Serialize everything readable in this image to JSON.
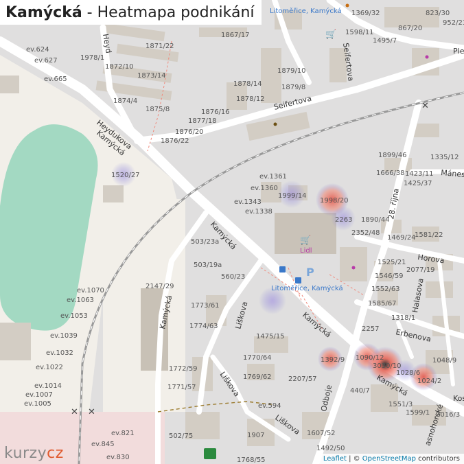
{
  "title": {
    "place": "Kamýcká",
    "separator": " - ",
    "subtitle": "Heatmapa podnikání"
  },
  "logo": {
    "part1": "kurzy",
    "part2": "cz"
  },
  "attribution": {
    "leaflet": "Leaflet",
    "sep": " | © ",
    "osm": "OpenStreetMap",
    "suffix": " contributors"
  },
  "streets": {
    "kamycka": "Kamýcká",
    "heydukova": "Heydukova",
    "seifertova": "Seifertova",
    "liskova": "Liškova",
    "odboje": "Odboje",
    "rijna": "28. října",
    "horova": "Horova",
    "halasova": "Halasova",
    "erbenova": "Erbenova",
    "manesova": "Mánes",
    "ples": "Ple",
    "kos": "Kos",
    "vodnohorske": "asnohorské",
    "heyd": "Heyd"
  },
  "pois": {
    "stop": "Litoměřice, Kamýcká",
    "stop2": "Litoměřice, Kamýcká",
    "lidl": "Lidl",
    "parking": "P"
  },
  "address_labels": [
    "1369/32",
    "823/30",
    "867/20",
    "952/23",
    "1598/11",
    "1495/7",
    "1867/17",
    "1871/22",
    "1978/1",
    "1872/10",
    "1873/14",
    "ev.624",
    "ev.627",
    "ev.665",
    "1879/10",
    "1878/14",
    "1879/8",
    "1874/4",
    "1875/8",
    "1878/12",
    "1876/16",
    "1877/18",
    "1876/20",
    "1876/22",
    "1335/12",
    "1899/46",
    "1666/38",
    "1423/11",
    "1425/37",
    "ev.1361",
    "ev.1360",
    "1999/14",
    "1998/20",
    "ev.1343",
    "ev.1338",
    "2263",
    "1890/44",
    "1520/27",
    "2352/48",
    "1469/24",
    "1581/22",
    "503/23a",
    "503/19a",
    "560/23",
    "1525/21",
    "2077/19",
    "1546/59",
    "1552/63",
    "1585/67",
    "2147/29",
    "ev.1070",
    "ev.1063",
    "1773/61",
    "1774/63",
    "ev.1053",
    "1318/1",
    "ev.1039",
    "1475/15",
    "1770/64",
    "2257",
    "1090/12",
    "3030/10",
    "1028/6",
    "1024/2",
    "1048/9",
    "ev.1032",
    "1392/9",
    "1772/59",
    "1769/62",
    "2207/57",
    "ev.1022",
    "1771/57",
    "440/7",
    "1551/3",
    "1599/1",
    "2016/3",
    "ev.1014",
    "ev.1007",
    "ev.1005",
    "ev.594",
    "1907",
    "1607/52",
    "ev.821",
    "502/75",
    "ev.845",
    "ev.830",
    "1768/55",
    "1492/50"
  ],
  "heatmap": [
    {
      "label": "1998/20",
      "level": 0.85
    },
    {
      "label": "3030/10",
      "level": 1.0
    },
    {
      "label": "1090/12",
      "level": 0.8
    },
    {
      "label": "1024/2",
      "level": 0.8
    },
    {
      "label": "1392/9",
      "level": 0.6
    }
  ],
  "colors": {
    "heat_high": "#333333",
    "heat_mid": "#e8685a",
    "heat_low": "#7a77d9",
    "park": "#a3d9c2",
    "building": "#d3cdc4",
    "road": "#ffffff",
    "background": "#e0dfdf"
  }
}
